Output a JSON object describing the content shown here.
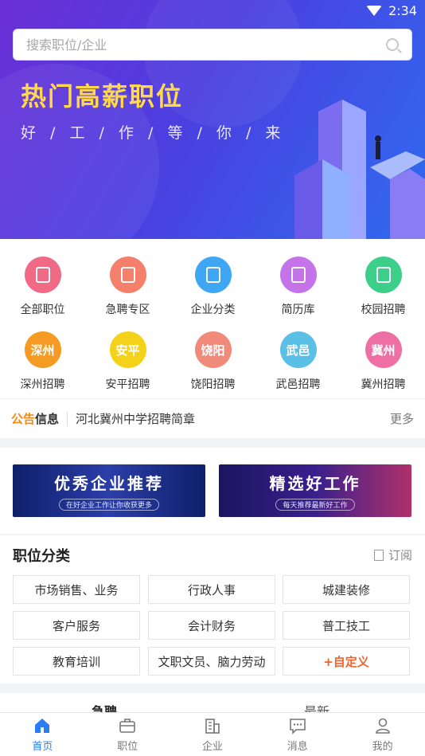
{
  "status": {
    "time": "2:34"
  },
  "search": {
    "placeholder": "搜索职位/企业"
  },
  "hero": {
    "title": "热门高薪职位",
    "subtitle": "好 / 工 / 作 / 等 / 你 / 来"
  },
  "categories": [
    {
      "label": "全部职位",
      "color": "#f06a86"
    },
    {
      "label": "急聘专区",
      "color": "#f47f6a"
    },
    {
      "label": "企业分类",
      "color": "#3ea6f2"
    },
    {
      "label": "简历库",
      "color": "#c473e8"
    },
    {
      "label": "校园招聘",
      "color": "#3ccf8a"
    },
    {
      "label": "深州招聘",
      "badge": "深州",
      "color": "#f59a22"
    },
    {
      "label": "安平招聘",
      "badge": "安平",
      "color": "#f5d21a"
    },
    {
      "label": "饶阳招聘",
      "badge": "饶阳",
      "color": "#f08a7a"
    },
    {
      "label": "武邑招聘",
      "badge": "武邑",
      "color": "#5cc0e6"
    },
    {
      "label": "冀州招聘",
      "badge": "冀州",
      "color": "#ee6fa3"
    }
  ],
  "notice": {
    "tag_a": "公告",
    "tag_b": "信息",
    "text": "河北冀州中学招聘简章",
    "more": "更多"
  },
  "banners": [
    {
      "title": "优秀企业推荐",
      "sub": "在好企业工作让你收获更多"
    },
    {
      "title": "精选好工作",
      "sub": "每天推荐最新好工作"
    }
  ],
  "jobs": {
    "title": "职位分类",
    "subscribe": "订阅",
    "items": [
      "市场销售、业务",
      "行政人事",
      "城建装修",
      "客户服务",
      "会计财务",
      "普工技工",
      "教育培训",
      "文职文员、脑力劳动",
      "+自定义"
    ]
  },
  "tabs": [
    "急聘",
    "最新"
  ],
  "nav": [
    {
      "label": "首页",
      "icon": "home-icon",
      "active": true
    },
    {
      "label": "职位",
      "icon": "briefcase-icon"
    },
    {
      "label": "企业",
      "icon": "building-icon"
    },
    {
      "label": "消息",
      "icon": "message-icon"
    },
    {
      "label": "我的",
      "icon": "user-icon"
    }
  ]
}
